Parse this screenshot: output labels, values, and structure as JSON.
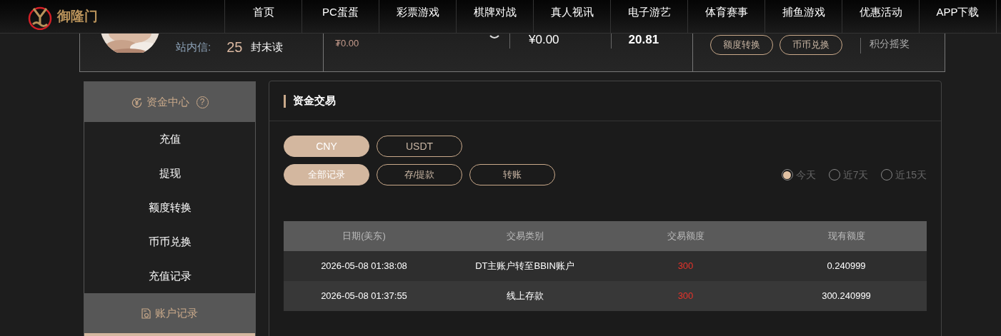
{
  "header": {
    "logo_text": "御隆门",
    "nav": [
      {
        "label": "首页"
      },
      {
        "label": "PC蛋蛋"
      },
      {
        "label": "彩票游戏"
      },
      {
        "label": "棋牌对战"
      },
      {
        "label": "真人视讯"
      },
      {
        "label": "电子游艺"
      },
      {
        "label": "体育赛事"
      },
      {
        "label": "捕鱼游戏"
      },
      {
        "label": "优惠活动"
      },
      {
        "label": "APP下载"
      }
    ]
  },
  "profile": {
    "avatar": {
      "kind": "picture"
    },
    "messages_label": "站内信:",
    "messages_count": "25",
    "messages_suffix": "封未读",
    "balance_small": "₮0.00",
    "balance_cny": "¥0.00",
    "balance_points": "20.81",
    "buttons": [
      "额度转换",
      "币币兑换"
    ],
    "lottery_label": "积分摇奖"
  },
  "sidebar": {
    "sections": [
      {
        "title": "资金中心",
        "kind": "funds",
        "help": "?",
        "items": [
          {
            "label": "充值"
          },
          {
            "label": "提现"
          },
          {
            "label": "额度转换"
          },
          {
            "label": "币币兑换"
          },
          {
            "label": "充值记录"
          }
        ]
      },
      {
        "title": "账户记录",
        "kind": "records"
      }
    ]
  },
  "panel": {
    "title": "资金交易",
    "currencies": [
      {
        "label": "CNY",
        "selected": true
      },
      {
        "label": "USDT",
        "selected": false
      }
    ],
    "filters": [
      {
        "label": "全部记录",
        "selected": true
      },
      {
        "label": "存/提款",
        "selected": false
      },
      {
        "label": "转账",
        "selected": false
      }
    ],
    "ranges": [
      {
        "label": "今天",
        "selected": true
      },
      {
        "label": "近7天",
        "selected": false
      },
      {
        "label": "近15天",
        "selected": false
      }
    ],
    "table": {
      "columns": [
        "日期(美东)",
        "交易类别",
        "交易额度",
        "现有额度"
      ],
      "rows": [
        {
          "date": "2026-05-08 01:38:08",
          "type": "DT主账户转至BBIN账户",
          "amount": "300",
          "balance": "0.240999"
        },
        {
          "date": "2026-05-08 01:37:55",
          "type": "线上存款",
          "amount": "300",
          "balance": "300.240999"
        }
      ]
    }
  }
}
